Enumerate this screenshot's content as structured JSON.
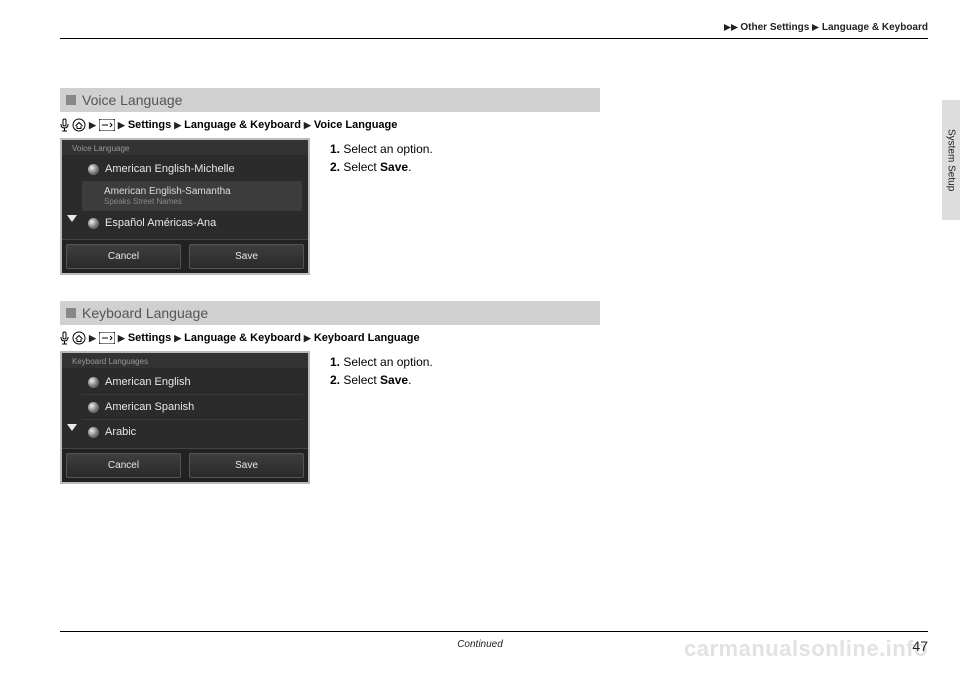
{
  "header": {
    "crumb1": "Other Settings",
    "crumb2": "Language & Keyboard"
  },
  "sideTab": "System Setup",
  "sections": [
    {
      "title": "Voice Language",
      "breadcrumb": [
        "Settings",
        "Language & Keyboard",
        "Voice Language"
      ],
      "screenshot": {
        "title": "Voice Language",
        "options": [
          {
            "type": "radio",
            "label": "American English-Michelle"
          },
          {
            "type": "sub",
            "line1": "American English-Samantha",
            "line2": "Speaks Street Names"
          },
          {
            "type": "radio",
            "label": "Español Américas-Ana"
          }
        ],
        "buttons": [
          "Cancel",
          "Save"
        ]
      },
      "instructions": [
        {
          "n": "1.",
          "text": "Select an option."
        },
        {
          "n": "2.",
          "text": "Select ",
          "bold": "Save",
          "after": "."
        }
      ]
    },
    {
      "title": "Keyboard Language",
      "breadcrumb": [
        "Settings",
        "Language & Keyboard",
        "Keyboard Language"
      ],
      "screenshot": {
        "title": "Keyboard Languages",
        "options": [
          {
            "type": "radio",
            "label": "American English"
          },
          {
            "type": "radio",
            "label": "American Spanish"
          },
          {
            "type": "radio",
            "label": "Arabic"
          }
        ],
        "buttons": [
          "Cancel",
          "Save"
        ]
      },
      "instructions": [
        {
          "n": "1.",
          "text": "Select an option."
        },
        {
          "n": "2.",
          "text": "Select ",
          "bold": "Save",
          "after": "."
        }
      ]
    }
  ],
  "continued": "Continued",
  "pageNumber": "47",
  "watermark": "carmanualsonline.info"
}
